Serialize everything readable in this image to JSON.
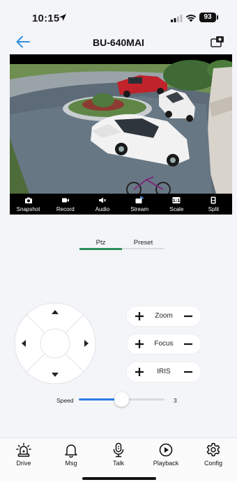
{
  "status_bar": {
    "time": "10:15",
    "battery": "93"
  },
  "header": {
    "title": "BU-640MAI"
  },
  "toolbar": {
    "items": [
      {
        "label": "Snapshot",
        "icon": "camera-icon"
      },
      {
        "label": "Record",
        "icon": "video-record-icon"
      },
      {
        "label": "Audio",
        "icon": "speaker-icon"
      },
      {
        "label": "Stream",
        "icon": "stream-icon"
      },
      {
        "label": "Scale",
        "icon": "scale-icon"
      },
      {
        "label": "Split",
        "icon": "split-icon"
      }
    ]
  },
  "tabs": {
    "ptz": "Ptz",
    "preset": "Preset",
    "active": "Ptz"
  },
  "controls": {
    "zoom": "Zoom",
    "focus": "Focus",
    "iris": "IRIS"
  },
  "speed": {
    "label": "Speed",
    "value": "3",
    "fraction": 0.5
  },
  "bottom_nav": {
    "drive": "Drive",
    "msg": "Msg",
    "talk": "Talk",
    "playback": "Playback",
    "config": "Config"
  },
  "colors": {
    "accent": "#2a7ee8",
    "tab_active": "#2c8f5a",
    "back_arrow": "#2f8fe0"
  }
}
